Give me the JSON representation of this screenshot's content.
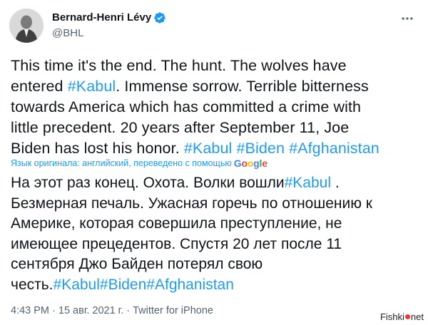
{
  "author": {
    "display_name": "Bernard-Henri Lévy",
    "handle": "@BHL",
    "verified_color": "#1d9bf0"
  },
  "tweet": {
    "lines": [
      [
        {
          "t": "This time it's the end. The hunt. The wolves have"
        }
      ],
      [
        {
          "t": "entered "
        },
        {
          "t": "#Kabul",
          "tag": true
        },
        {
          "t": ". Immense sorrow. Terrible bitterness"
        }
      ],
      [
        {
          "t": "towards America which has committed a crime with"
        }
      ],
      [
        {
          "t": "little  precedent. 20 years after September 11, Joe"
        }
      ],
      [
        {
          "t": "Biden has lost his honor. "
        },
        {
          "t": "#Kabul",
          "tag": true
        },
        {
          "t": " "
        },
        {
          "t": "#Biden",
          "tag": true
        },
        {
          "t": " "
        },
        {
          "t": "#Afghanistan",
          "tag": true
        }
      ]
    ]
  },
  "translation": {
    "notice": "Язык оригинала: английский, переведено с помощью",
    "provider": "Google",
    "lines": [
      [
        {
          "t": "На этот раз конец. Охота. Волки вошли"
        },
        {
          "t": "#Kabul",
          "tag": true
        },
        {
          "t": " ."
        }
      ],
      [
        {
          "t": "Безмерная печаль. Ужасная горечь по отношению к"
        }
      ],
      [
        {
          "t": "Америке, которая совершила преступление, не"
        }
      ],
      [
        {
          "t": "имеющее прецедентов. Спустя 20 лет после 11"
        }
      ],
      [
        {
          "t": "сентября Джо Байден потерял свою"
        }
      ],
      [
        {
          "t": "честь."
        },
        {
          "t": "#Kabul",
          "tag": true
        },
        {
          "t": "#Biden",
          "tag": true
        },
        {
          "t": "#Afghanistan",
          "tag": true
        }
      ]
    ]
  },
  "meta": {
    "time": "4:43 PM",
    "separator": " · ",
    "date": "15 авг. 2021 г.",
    "source": "Twitter for iPhone"
  },
  "watermark": {
    "text_before": "Fishki",
    "text_after": "net"
  },
  "colors": {
    "hashtag": "#1d9bf0",
    "secondary_text": "#536471",
    "google": [
      "#4285F4",
      "#EA4335",
      "#FBBC05",
      "#4285F4",
      "#34A853",
      "#EA4335"
    ]
  },
  "icons": {
    "verified": "verified-badge-icon",
    "more": "more-options-icon",
    "avatar": "profile-photo"
  }
}
